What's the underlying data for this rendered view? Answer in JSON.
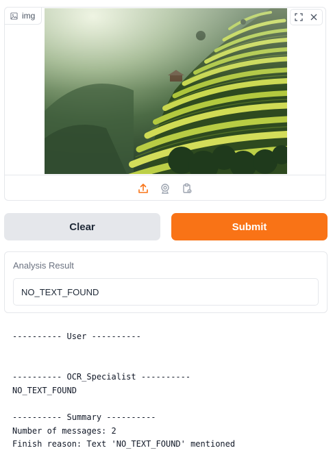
{
  "image_input": {
    "label": "img",
    "icons": {
      "label": "image-icon",
      "fullscreen": "fullscreen-icon",
      "clear": "close-icon",
      "upload": "upload-icon",
      "webcam": "webcam-icon",
      "clipboard": "clipboard-icon"
    }
  },
  "buttons": {
    "clear_label": "Clear",
    "submit_label": "Submit"
  },
  "result": {
    "label": "Analysis Result",
    "value": "NO_TEXT_FOUND"
  },
  "log": {
    "user_header": "---------- User ----------",
    "ocr_header": "---------- OCR_Specialist ----------",
    "ocr_output": "NO_TEXT_FOUND",
    "summary_header": "---------- Summary ----------",
    "messages_line": "Number of messages: 2",
    "finish_line": "Finish reason: Text 'NO_TEXT_FOUND' mentioned"
  },
  "colors": {
    "accent": "#f97316",
    "secondary_button": "#e5e7eb",
    "border": "#e5e7eb"
  }
}
